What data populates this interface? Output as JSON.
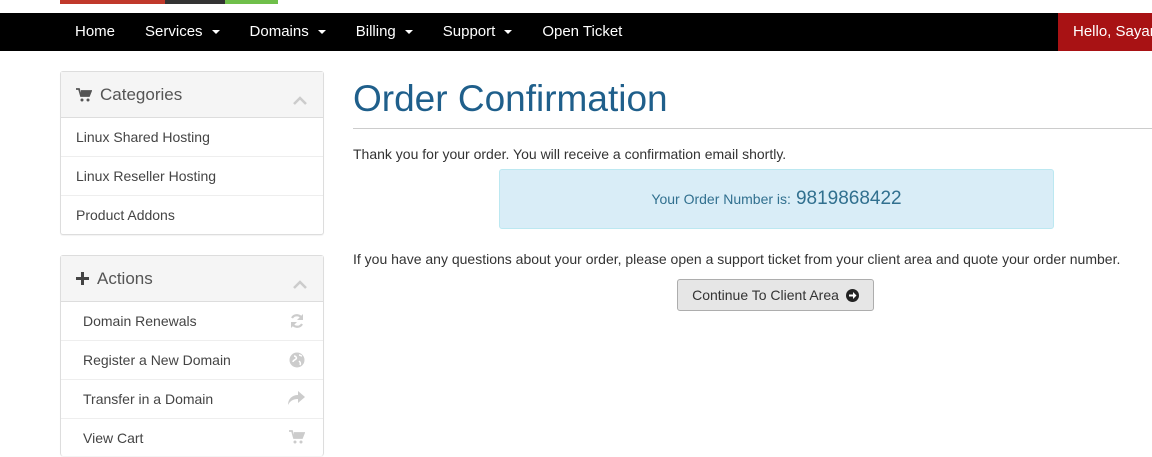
{
  "nav": {
    "items": [
      {
        "label": "Home",
        "dropdown": false
      },
      {
        "label": "Services",
        "dropdown": true
      },
      {
        "label": "Domains",
        "dropdown": true
      },
      {
        "label": "Billing",
        "dropdown": true
      },
      {
        "label": "Support",
        "dropdown": true
      },
      {
        "label": "Open Ticket",
        "dropdown": false
      }
    ],
    "hello": "Hello, Sayan"
  },
  "sidebar": {
    "categories": {
      "title": "Categories",
      "icon": "shopping-cart-icon",
      "items": [
        {
          "label": "Linux Shared Hosting"
        },
        {
          "label": "Linux Reseller Hosting"
        },
        {
          "label": "Product Addons"
        }
      ]
    },
    "actions": {
      "title": "Actions",
      "icon": "plus-icon",
      "items": [
        {
          "label": "Domain Renewals",
          "icon": "refresh-icon"
        },
        {
          "label": "Register a New Domain",
          "icon": "globe-icon"
        },
        {
          "label": "Transfer in a Domain",
          "icon": "share-arrow-icon"
        },
        {
          "label": "View Cart",
          "icon": "shopping-cart-icon"
        }
      ]
    }
  },
  "main": {
    "title": "Order Confirmation",
    "thank_you": "Thank you for your order. You will receive a confirmation email shortly.",
    "order_label": "Your Order Number is:",
    "order_number": "9819868422",
    "questions": "If you have any questions about your order, please open a support ticket from your client area and quote your order number.",
    "continue_button": "Continue To Client Area"
  },
  "colors": {
    "navbar": "#000000",
    "hello_bg": "#a81214",
    "title": "#1f5f8b",
    "alert_bg": "#d9edf7",
    "alert_text": "#31708f"
  }
}
